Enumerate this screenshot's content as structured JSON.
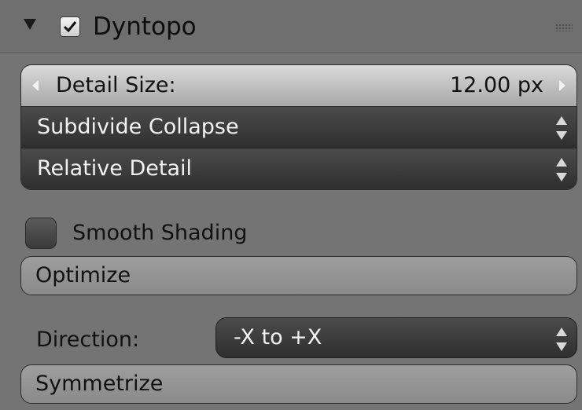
{
  "panel": {
    "title": "Dyntopo",
    "enabled": true
  },
  "detail_size": {
    "label": "Detail Size:",
    "value": "12.00 px"
  },
  "refine_method": {
    "selected": "Subdivide Collapse"
  },
  "detail_type": {
    "selected": "Relative Detail"
  },
  "smooth_shading": {
    "label": "Smooth Shading",
    "checked": false
  },
  "optimize": {
    "label": "Optimize"
  },
  "direction": {
    "label": "Direction:",
    "selected": "-X to +X"
  },
  "symmetrize": {
    "label": "Symmetrize"
  },
  "colors": {
    "panel_bg": "#747474",
    "dark_menu": "#3a3a3a",
    "number_field": "#c4c4c4"
  }
}
